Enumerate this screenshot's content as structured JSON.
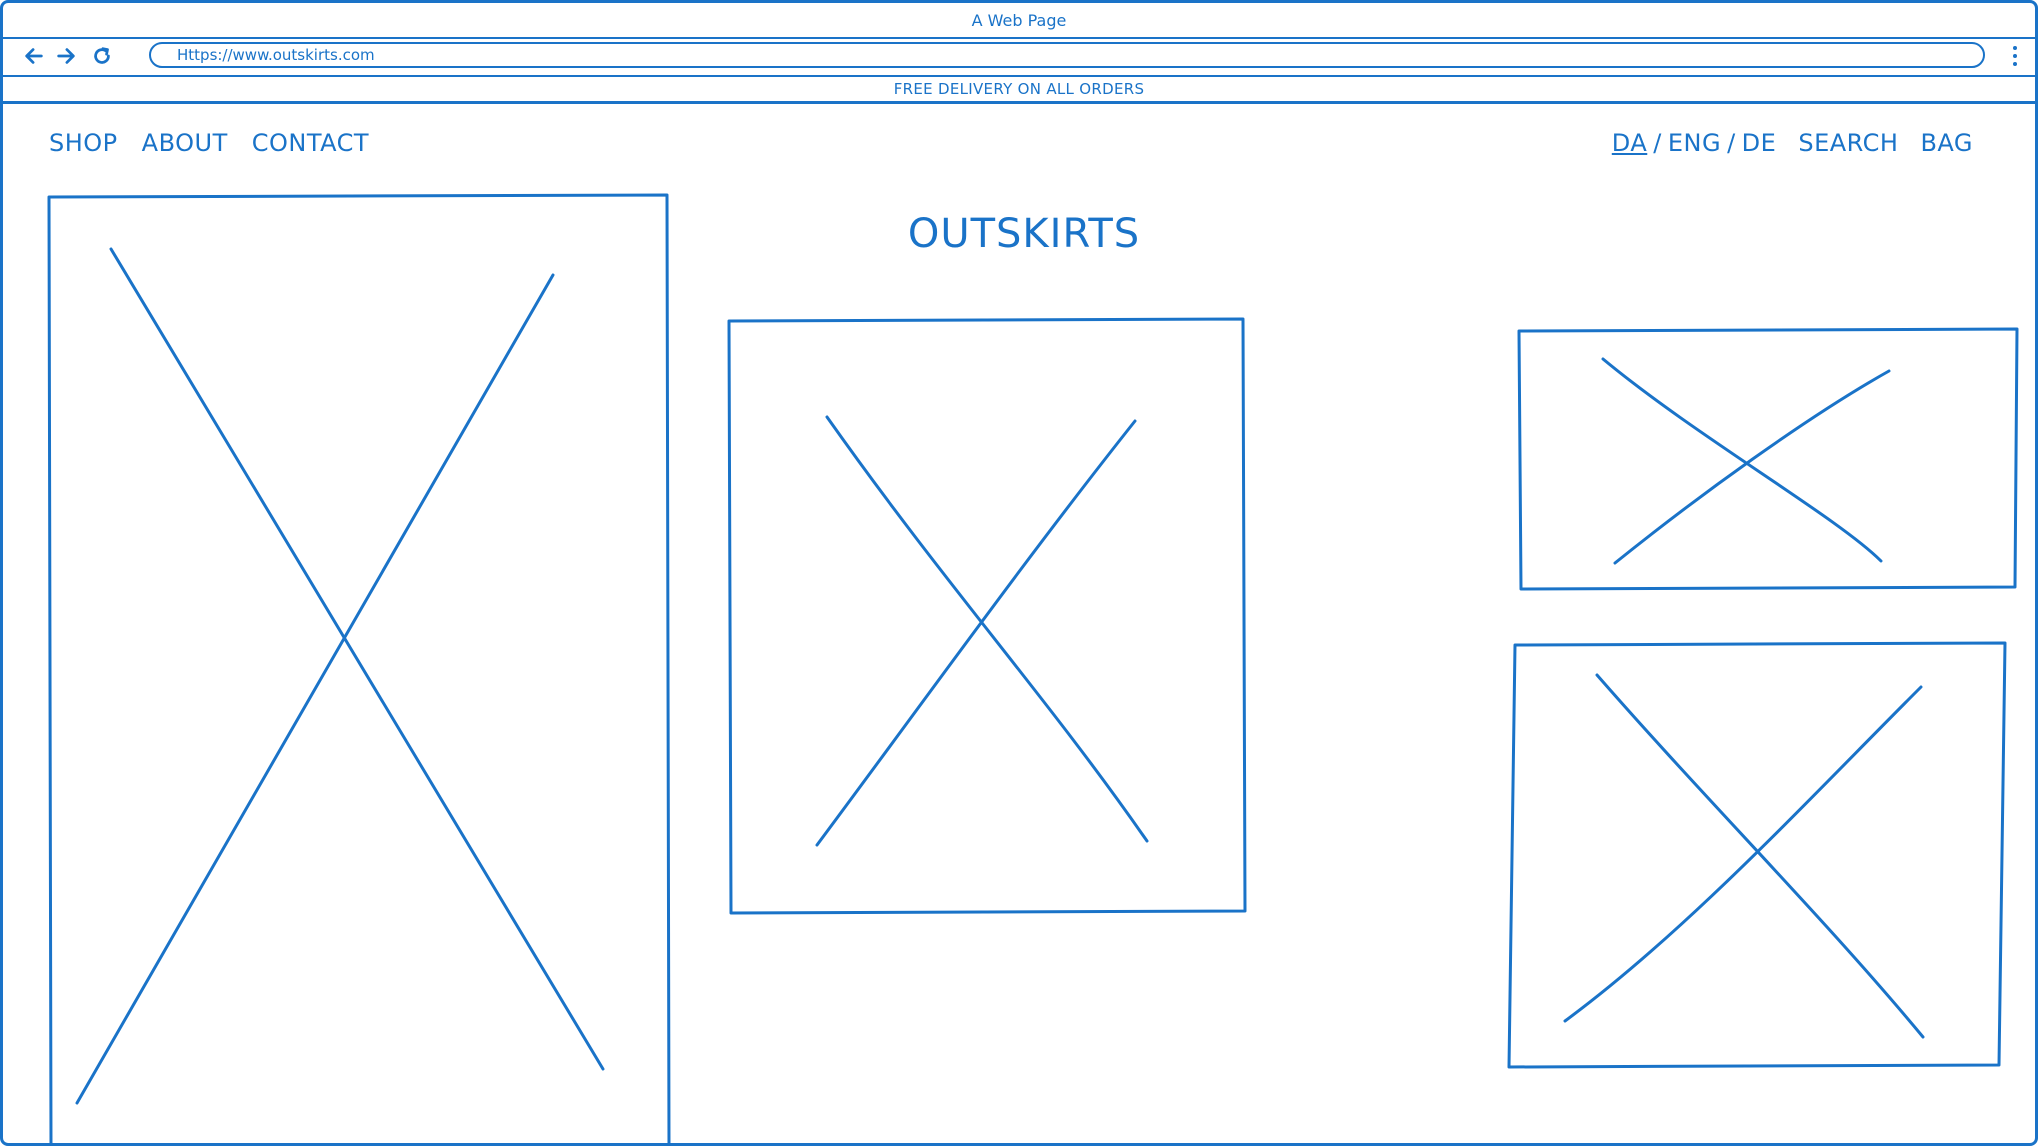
{
  "window": {
    "title": "A Web Page"
  },
  "browser": {
    "url": "Https://www.outskirts.com",
    "back_icon": "arrow-left-icon",
    "forward_icon": "arrow-right-icon",
    "reload_icon": "reload-icon",
    "menu_icon": "kebab-menu-icon"
  },
  "promo_banner": {
    "text": "FREE DELIVERY ON ALL ORDERS"
  },
  "site_nav": {
    "left": [
      {
        "label": "SHOP"
      },
      {
        "label": "ABOUT"
      },
      {
        "label": "CONTACT"
      }
    ],
    "languages": {
      "da": "DA",
      "sep1": "/",
      "eng": "ENG",
      "sep2": "/",
      "de": "DE"
    },
    "search": "SEARCH",
    "bag": "BAG"
  },
  "brand": {
    "name": "OUTSKIRTS"
  },
  "colors": {
    "stroke": "#1a73c8",
    "background": "#ffffff"
  }
}
